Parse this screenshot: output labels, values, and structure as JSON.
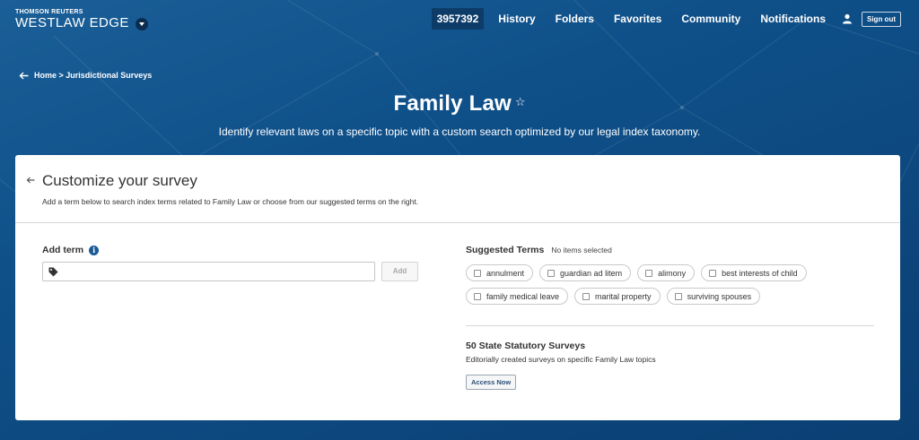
{
  "header": {
    "company": "THOMSON REUTERS",
    "product": "WESTLAW EDGE",
    "client_id": "3957392",
    "nav": [
      "History",
      "Folders",
      "Favorites",
      "Community",
      "Notifications"
    ],
    "sign_out": "Sign out"
  },
  "breadcrumb": {
    "text": "Home > Jurisdictional Surveys"
  },
  "hero": {
    "title": "Family Law",
    "star": "☆",
    "subtitle": "Identify relevant laws on a specific topic with a custom search optimized by our legal index taxonomy."
  },
  "card": {
    "title": "Customize your survey",
    "description": "Add a term below to search index terms related to Family Law or choose from our suggested terms on the right.",
    "add_term": {
      "label": "Add term",
      "info": "i",
      "input_value": "",
      "placeholder": "",
      "add_button": "Add"
    },
    "suggested": {
      "heading": "Suggested Terms",
      "status": "No items selected",
      "terms": [
        "annulment",
        "guardian ad litem",
        "alimony",
        "best interests of child",
        "family medical leave",
        "marital property",
        "surviving spouses"
      ]
    },
    "statutory": {
      "title": "50 State Statutory Surveys",
      "description": "Editorially created surveys on specific Family Law topics",
      "button": "Access Now"
    }
  },
  "colors": {
    "background": "#0f5089",
    "accent": "#1a5a96",
    "card": "#ffffff"
  },
  "icons": [
    "caret-down-icon",
    "user-icon",
    "back-arrow-icon",
    "star-icon",
    "info-icon",
    "tag-icon",
    "checkbox-icon"
  ]
}
